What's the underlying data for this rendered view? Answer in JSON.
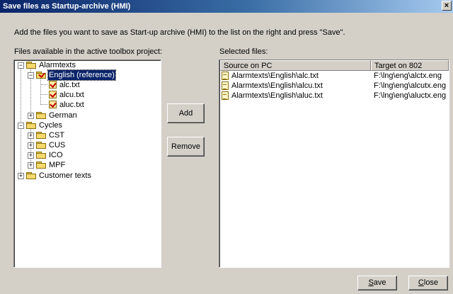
{
  "window": {
    "title": "Save files as Startup-archive (HMI)",
    "close_glyph": "×"
  },
  "instruction": "Add the files you want to save as Start-up archive (HMI) to the list on the right and press \"Save\".",
  "left_panel": {
    "label": "Files available in the active toolbox project:",
    "tree": {
      "alarmtexts": "Alarmtexts",
      "english": "English (reference)",
      "files": [
        "alc.txt",
        "alcu.txt",
        "aluc.txt"
      ],
      "german": "German",
      "cycles": "Cycles",
      "cycle_children": [
        "CST",
        "CUS",
        "ICO",
        "MPF"
      ],
      "customer_texts": "Customer texts"
    }
  },
  "buttons": {
    "add": "Add",
    "remove": "Remove",
    "save_mnemonic": "S",
    "save_rest": "ave",
    "close_mnemonic": "C",
    "close_rest": "lose"
  },
  "right_panel": {
    "label": "Selected files:",
    "columns": [
      "Source on PC",
      "Target on 802"
    ],
    "rows": [
      {
        "source": "Alarmtexts\\English\\alc.txt",
        "target": "F:\\lng\\eng\\alctx.eng"
      },
      {
        "source": "Alarmtexts\\English\\alcu.txt",
        "target": "F:\\lng\\eng\\alcutx.eng"
      },
      {
        "source": "Alarmtexts\\English\\aluc.txt",
        "target": "F:\\lng\\eng\\aluctx.eng"
      }
    ]
  }
}
